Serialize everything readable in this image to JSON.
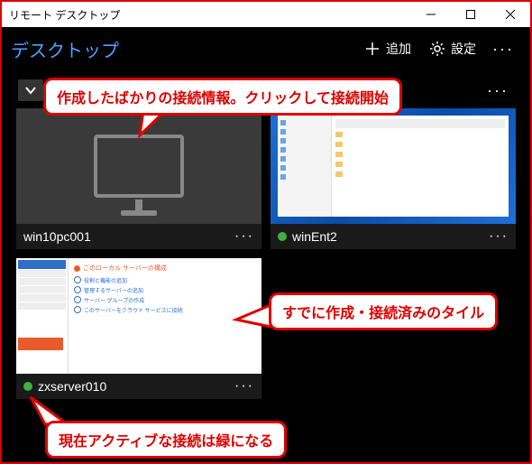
{
  "window": {
    "title": "リモート デスクトップ"
  },
  "header": {
    "title": "デスクトップ",
    "add_label": "追加",
    "settings_label": "設定"
  },
  "tiles": [
    {
      "name": "win10pc001",
      "active": false,
      "thumb": "monitor"
    },
    {
      "name": "winEnt2",
      "active": true,
      "thumb": "explorer"
    },
    {
      "name": "zxserver010",
      "active": true,
      "thumb": "server"
    }
  ],
  "callouts": {
    "c1": "作成したばかりの接続情報。クリックして接続開始",
    "c2": "すでに作成・接続済みのタイル",
    "c3": "現在アクティブな接続は緑になる"
  },
  "colors": {
    "accent": "#4aa3ff",
    "active_dot": "#3fb03f",
    "callout": "#d00"
  }
}
